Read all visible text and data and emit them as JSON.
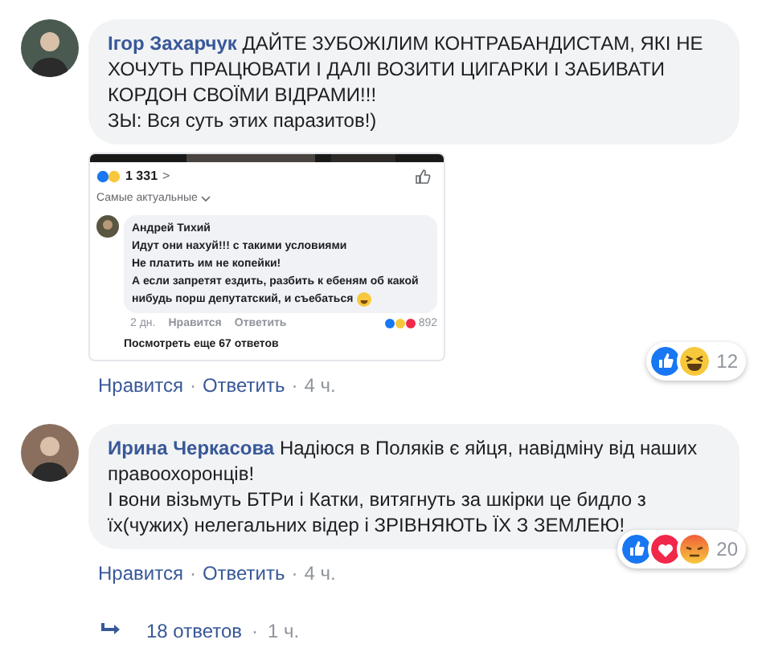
{
  "comments": [
    {
      "author": "Ігор Захарчук",
      "text": "ДАЙТЕ ЗУБОЖІЛИМ КОНТРАБАНДИСТАМ, ЯКІ НЕ ХОЧУТЬ ПРАЦЮВАТИ І ДАЛІ ВОЗИТИ ЦИГАРКИ І ЗАБИВАТИ КОРДОН СВОЇМИ ВІДРАМИ!!!",
      "text2": "ЗЫ: Вся суть этих паразитов!)",
      "attachment": {
        "reactions_count": "1 331",
        "chevron": ">",
        "sort": "Самые актуальные",
        "reply": {
          "author": "Андрей Тихий",
          "lines": [
            "Идут они нахуй!!!  с такими условиями",
            "Не платить им не копейки!",
            "А если запретят ездить,  разбить к ебеням об какой",
            "нибудь порш депутатский,  и съебаться"
          ],
          "time": "2 дн.",
          "like": "Нравится",
          "answer": "Ответить",
          "count": "892"
        },
        "more": "Посмотреть еще 67 ответов"
      },
      "reaction_count": "12",
      "actions": [
        "Нравится",
        "·",
        "Ответить",
        "·",
        "4 ч."
      ]
    },
    {
      "author": "Ирина Черкасова",
      "text": "Надіюся в Поляків є яйця, навідміну від наших правоохоронців!",
      "text2": "І вони візьмуть БТРи і Катки, витягнуть за шкірки це бидло з їх(чужих) нелегальних відер і ЗРІВНЯЮТЬ ЇХ З ЗЕМЛЕЮ!",
      "reaction_count": "20",
      "actions": [
        "Нравится",
        "·",
        "Ответить",
        "·",
        "4 ч."
      ],
      "replies": {
        "label": "18 ответов",
        "separator": "·",
        "time": "1 ч."
      }
    }
  ]
}
